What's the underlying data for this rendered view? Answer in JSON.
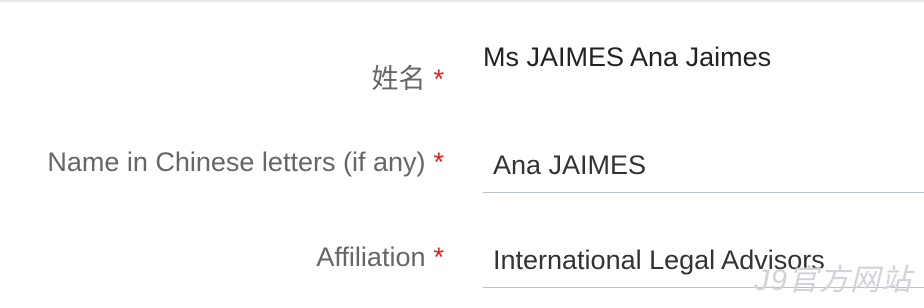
{
  "form": {
    "rows": [
      {
        "label": "姓名",
        "required_mark": "*",
        "value": "Ms JAIMES Ana Jaimes"
      },
      {
        "label": "Name in Chinese letters (if any)",
        "required_mark": "*",
        "value": "Ana JAIMES"
      },
      {
        "label": "Affiliation",
        "required_mark": "*",
        "value": "International Legal Advisors"
      }
    ]
  },
  "watermark": {
    "text": "J9官方网站"
  },
  "colors": {
    "label": "#666666",
    "required": "#e02020",
    "value": "#333333",
    "underline": "#b9bfcc",
    "watermark": "#d0d3da"
  }
}
